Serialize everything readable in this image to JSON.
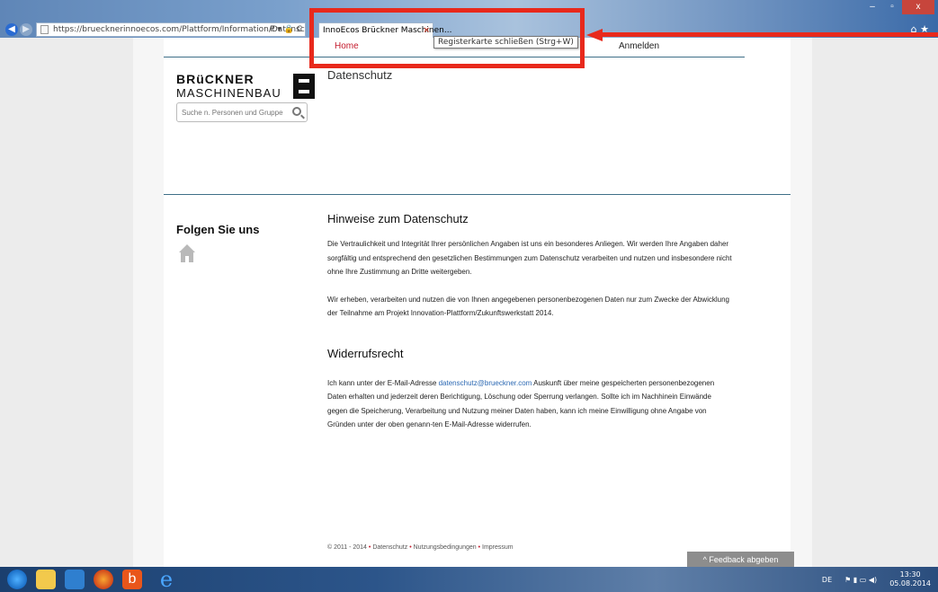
{
  "browser": {
    "url_prefix": "https://bruecknerinnoecos.com/Plattform/Information/Datenschu",
    "url_host_part": "innoecos.com",
    "url_tools": "P ▾ 🔒 C",
    "tab_title": "InnoEcos Brückner Maschinen...",
    "tab_close": "×",
    "tooltip": "Registerkarte schließen (Strg+W)",
    "window_buttons": [
      "–",
      "▫",
      "x"
    ],
    "right_icons": "⌂ ★"
  },
  "nav": {
    "home": "Home",
    "login": "Anmelden"
  },
  "sidebar": {
    "logo_line1": "BRüCKNER",
    "logo_line2": "MASCHINENBAU",
    "search_placeholder": "Suche n. Personen und Gruppen",
    "follow_heading": "Folgen Sie uns"
  },
  "page_title": "Datenschutz",
  "article": {
    "heading1": "Hinweise zum Datenschutz",
    "p1": "Die Vertraulichkeit und Integrität Ihrer persönlichen Angaben ist uns ein besonderes Anliegen. Wir werden Ihre Angaben daher sorgfältig und entsprechend den gesetzlichen Bestimmungen zum Datenschutz verarbeiten und nutzen und insbesondere nicht ohne Ihre Zustimmung an Dritte weitergeben.",
    "p2": "Wir erheben, verarbeiten und nutzen die von Ihnen angegebenen personenbezogenen Daten nur zum Zwecke der Abwicklung der Teilnahme am Projekt Innovation-Plattform/Zukunftswerkstatt 2014.",
    "heading2": "Widerrufsrecht",
    "p3_before": "Ich kann unter der E-Mail-Adresse ",
    "p3_email": "datenschutz@brueckner.com",
    "p3_after": " Auskunft über meine gespeicherten personenbezogenen Daten erhalten und jederzeit deren Berichtigung, Löschung oder Sperrung verlangen. Sollte ich im Nachhinein Einwände gegen die Speicherung, Verarbeitung und Nutzung meiner Daten haben, kann ich meine Einwilligung ohne Angabe von Gründen unter der oben genann-ten E-Mail-Adresse widerrufen."
  },
  "footer": {
    "copyright": "© 2011 - 2014",
    "link1": "Datenschutz",
    "link2": "Nutzungsbedingungen",
    "link3": "Impressum",
    "separator": "•"
  },
  "feedback_button": "^ Feedback abgeben",
  "taskbar": {
    "bing_label": "b",
    "ie_label": "e",
    "language": "DE",
    "time": "13:30",
    "date": "05.08.2014"
  },
  "colors": {
    "highlight": "#e8291c",
    "nav_active": "#c41a2c",
    "link": "#2b68b3"
  }
}
